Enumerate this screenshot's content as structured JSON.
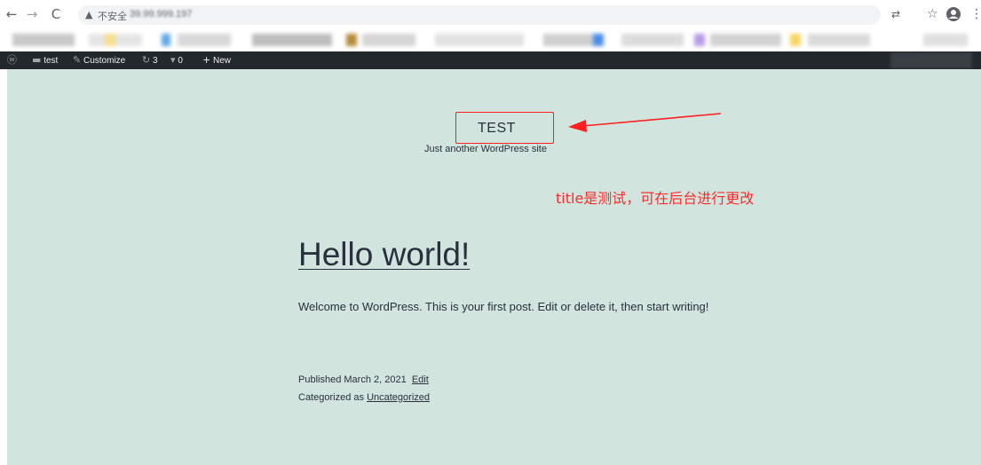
{
  "browser": {
    "nav": {
      "back": "←",
      "forward": "→",
      "reload": "C"
    },
    "address": {
      "warning_icon": "warning-triangle-icon",
      "security_label": "不安全",
      "separator": "|",
      "url": "39.99.999.197"
    },
    "right_icons": [
      "translate-icon",
      "star-icon",
      "account-icon",
      "menu-icon"
    ]
  },
  "adminbar": {
    "items": [
      {
        "icon": "wordpress-logo-icon",
        "label": ""
      },
      {
        "icon": "home-icon",
        "label": "test"
      },
      {
        "icon": "brush-icon",
        "label": "Customize"
      },
      {
        "icon": "updates-icon",
        "label": "3"
      },
      {
        "icon": "comment-icon",
        "label": "0"
      },
      {
        "icon": "plus-icon",
        "label": "New"
      }
    ]
  },
  "site": {
    "title": "TEST",
    "description": "Just another WordPress site"
  },
  "annotation": {
    "text": "title是测试，可在后台进行更改",
    "color": "#ff2b2b"
  },
  "post": {
    "title": "Hello world!",
    "content": "Welcome to WordPress. This is your first post. Edit or delete it, then start writing!",
    "published_prefix": "Published",
    "date": "March 2, 2021",
    "edit_label": "Edit",
    "categorized_prefix": "Categorized as",
    "category": "Uncategorized"
  },
  "colors": {
    "background": "#d1e4dd",
    "text": "#28303d",
    "adminbar": "#23282d"
  }
}
